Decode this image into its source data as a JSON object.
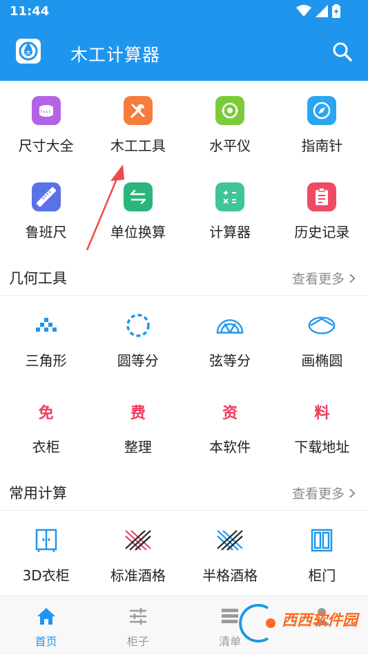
{
  "status_bar": {
    "time": "11:44"
  },
  "app_bar": {
    "title": "木工计算器"
  },
  "tools": [
    {
      "label": "尺寸大全",
      "icon": "size-catalog-icon",
      "color": "#b463e5"
    },
    {
      "label": "木工工具",
      "icon": "tools-icon",
      "color": "#f57c3a"
    },
    {
      "label": "水平仪",
      "icon": "level-icon",
      "color": "#7ccb3a"
    },
    {
      "label": "指南针",
      "icon": "compass-icon",
      "color": "#2ba5f2"
    },
    {
      "label": "鲁班尺",
      "icon": "ruler-icon",
      "color": "#5a72e8"
    },
    {
      "label": "单位换算",
      "icon": "unit-convert-icon",
      "color": "#29b57c"
    },
    {
      "label": "计算器",
      "icon": "calculator-icon",
      "color": "#40c49a"
    },
    {
      "label": "历史记录",
      "icon": "history-icon",
      "color": "#ef4a63"
    }
  ],
  "geometry": {
    "title": "几何工具",
    "more": "查看更多",
    "items": [
      {
        "label": "三角形",
        "icon": "triangle-icon"
      },
      {
        "label": "圆等分",
        "icon": "circle-divide-icon"
      },
      {
        "label": "弦等分",
        "icon": "chord-divide-icon"
      },
      {
        "label": "画椭圆",
        "icon": "ellipse-icon"
      },
      {
        "label": "衣柜",
        "badge": "免"
      },
      {
        "label": "整理",
        "badge": "费"
      },
      {
        "label": "本软件",
        "badge": "资"
      },
      {
        "label": "下载地址",
        "badge": "料"
      }
    ]
  },
  "common": {
    "title": "常用计算",
    "more": "查看更多",
    "items": [
      {
        "label": "3D衣柜",
        "icon": "wardrobe-icon"
      },
      {
        "label": "标准酒格",
        "icon": "wine-rack-icon"
      },
      {
        "label": "半格酒格",
        "icon": "half-wine-rack-icon"
      },
      {
        "label": "柜门",
        "icon": "cabinet-door-icon"
      }
    ]
  },
  "tabs": [
    {
      "label": "首页",
      "icon": "home-icon",
      "active": true
    },
    {
      "label": "柜子",
      "icon": "sliders-icon",
      "active": false
    },
    {
      "label": "清单",
      "icon": "list-icon",
      "active": false
    },
    {
      "label": "",
      "icon": "profile-icon",
      "active": false
    }
  ],
  "watermark": {
    "text": "西西软件园",
    "sub": "CR173.COM"
  },
  "colors": {
    "primary": "#1f96ee",
    "accent_red": "#ef3b5b"
  }
}
